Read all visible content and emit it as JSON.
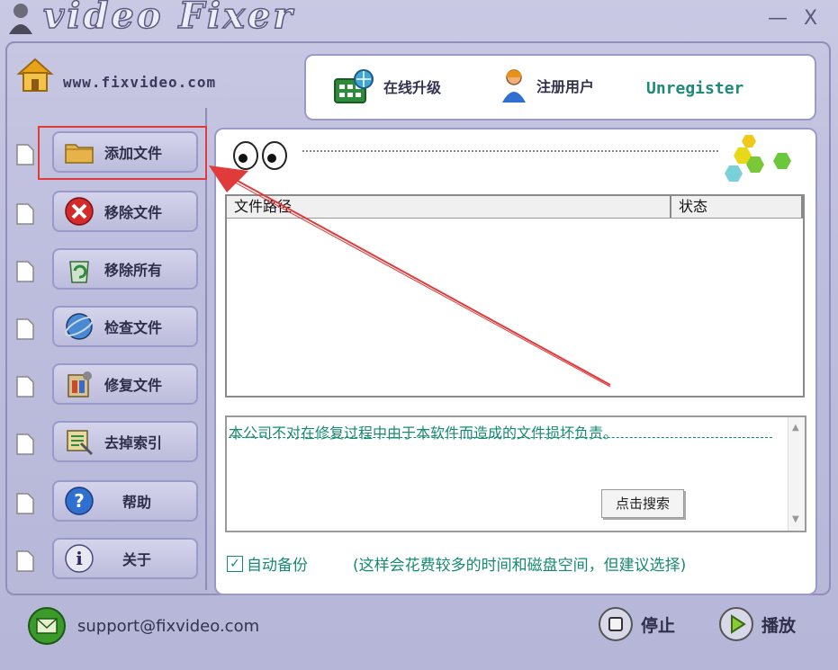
{
  "window": {
    "title": "video Fixer",
    "minimize_glyph": "—",
    "close_glyph": "X"
  },
  "header": {
    "website": "www.fixvideo.com",
    "upgrade_label": "在线升级",
    "register_label": "注册用户",
    "registration_status": "Unregister"
  },
  "sidebar": {
    "items": [
      {
        "label": "添加文件",
        "icon": "folder-icon"
      },
      {
        "label": "移除文件",
        "icon": "remove-icon"
      },
      {
        "label": "移除所有",
        "icon": "recycle-icon"
      },
      {
        "label": "检查文件",
        "icon": "globe-check-icon"
      },
      {
        "label": "修复文件",
        "icon": "repair-icon"
      },
      {
        "label": "去掉索引",
        "icon": "index-icon"
      },
      {
        "label": "帮助",
        "icon": "help-icon"
      },
      {
        "label": "关于",
        "icon": "info-icon"
      }
    ]
  },
  "file_table": {
    "columns": [
      "文件路径",
      "状态"
    ],
    "rows": []
  },
  "log": {
    "message": "本公司不对在修复过程中由于本软件而造成的文件损坏负责。",
    "search_button": "点击搜索"
  },
  "backup": {
    "checked": true,
    "check_glyph": "✓",
    "label": "自动备份",
    "note": "(这样会花费较多的时间和磁盘空间，但建议选择)"
  },
  "footer": {
    "support_email": "support@fixvideo.com",
    "stop_label": "停止",
    "play_label": "播放"
  },
  "colors": {
    "accent_teal": "#158a72",
    "highlight_red": "#e03a3a",
    "frame": "#9a9ac6"
  }
}
